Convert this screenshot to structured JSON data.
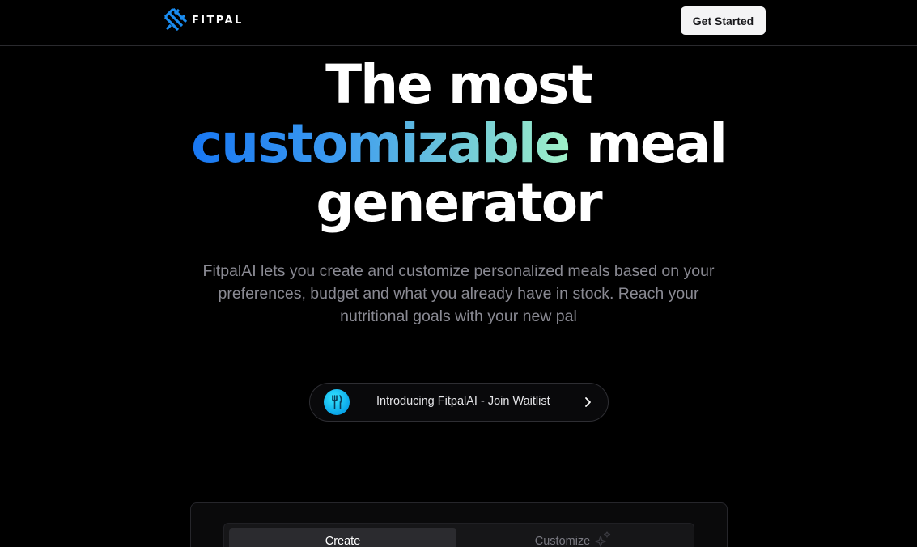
{
  "header": {
    "brand": "FITPAL",
    "cta_label": "Get Started"
  },
  "hero": {
    "title_line1": "The most",
    "title_highlight": "customizable",
    "title_after_highlight": " meal",
    "title_line3": "generator",
    "subtitle": "FitpalAI lets you create and customize personalized meals based on your preferences, budget and what you already have in stock. Reach your nutritional goals with your new pal"
  },
  "announcement": {
    "icon": "fork-knife-icon",
    "label": "Introducing FitpalAI - Join Waitlist"
  },
  "card": {
    "tabs": [
      {
        "label": "Create",
        "active": true
      },
      {
        "label": "Customize",
        "active": false,
        "icon": "sparkle-icon"
      }
    ]
  },
  "colors": {
    "background": "#000000",
    "brand_blue": "#1877f2",
    "gradient_end": "#9ff0c8",
    "pill_icon": "#0aa6ea"
  }
}
